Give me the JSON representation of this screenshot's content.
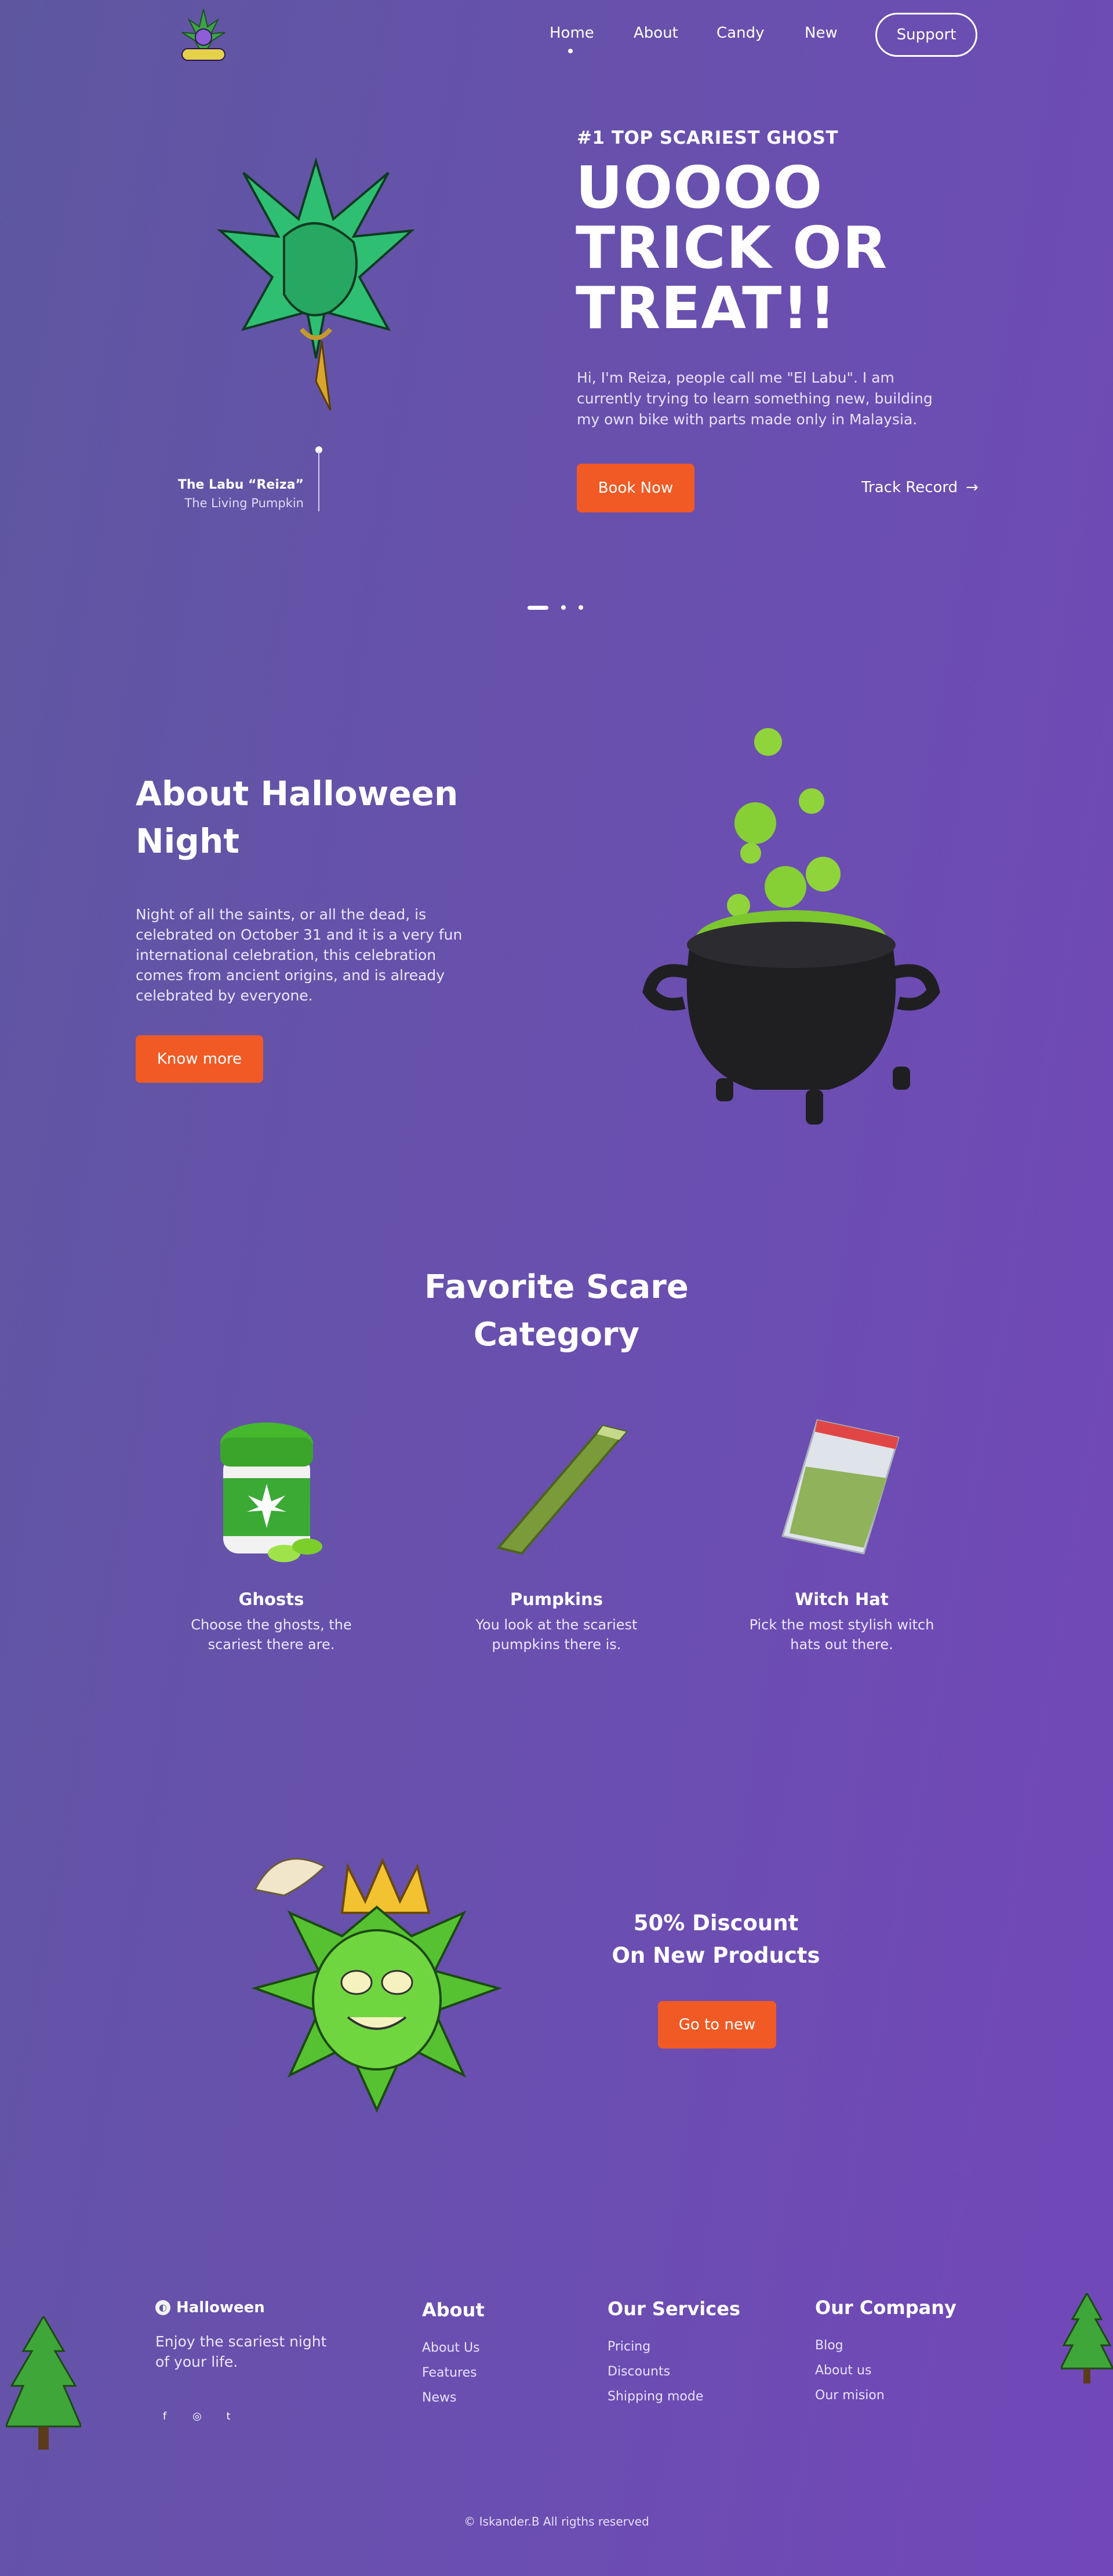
{
  "nav": {
    "links": [
      "Home",
      "About",
      "Candy",
      "New"
    ],
    "support_label": "Support"
  },
  "hero": {
    "eyebrow": "#1 TOP SCARIEST GHOST",
    "title_line1": "UOOOO",
    "title_line2": "TRICK OR",
    "title_line3": "TREAT!!",
    "description": "Hi, I'm Reiza, people call me \"El Labu\". I am currently trying to learn something new, building my own bike with parts made only in Malaysia.",
    "book_label": "Book Now",
    "track_label": "Track Record",
    "caption_name": "The Labu “Reiza”",
    "caption_sub": "The Living Pumpkin"
  },
  "about": {
    "title": "About Halloween Night",
    "description": "Night of all the saints, or all the dead, is celebrated on October 31 and it is a very fun international celebration, this celebration comes from ancient origins, and is already celebrated by everyone.",
    "button_label": "Know more"
  },
  "categories": {
    "title": "Favorite Scare Category",
    "items": [
      {
        "name": "Ghosts",
        "description": "Choose the ghosts, the scariest there are."
      },
      {
        "name": "Pumpkins",
        "description": "You look at the scariest pumpkins there is."
      },
      {
        "name": "Witch Hat",
        "description": "Pick the most stylish witch hats out there."
      }
    ]
  },
  "discount": {
    "line1": "50% Discount",
    "line2": "On New Products",
    "button_label": "Go to new"
  },
  "footer": {
    "brand": "Halloween",
    "tagline": "Enjoy the scariest night of your life.",
    "social": [
      "f",
      "◎",
      "t"
    ],
    "columns": [
      {
        "heading": "About",
        "links": [
          "About Us",
          "Features",
          "News"
        ]
      },
      {
        "heading": "Our Services",
        "links": [
          "Pricing",
          "Discounts",
          "Shipping mode"
        ]
      },
      {
        "heading": "Our Company",
        "links": [
          "Blog",
          "About us",
          "Our mision"
        ]
      }
    ],
    "copyright": "© Iskander.B All rigths reserved"
  },
  "colors": {
    "accent": "#f15a24",
    "bg_start": "#5e57a0",
    "bg_end": "#7247b9"
  }
}
